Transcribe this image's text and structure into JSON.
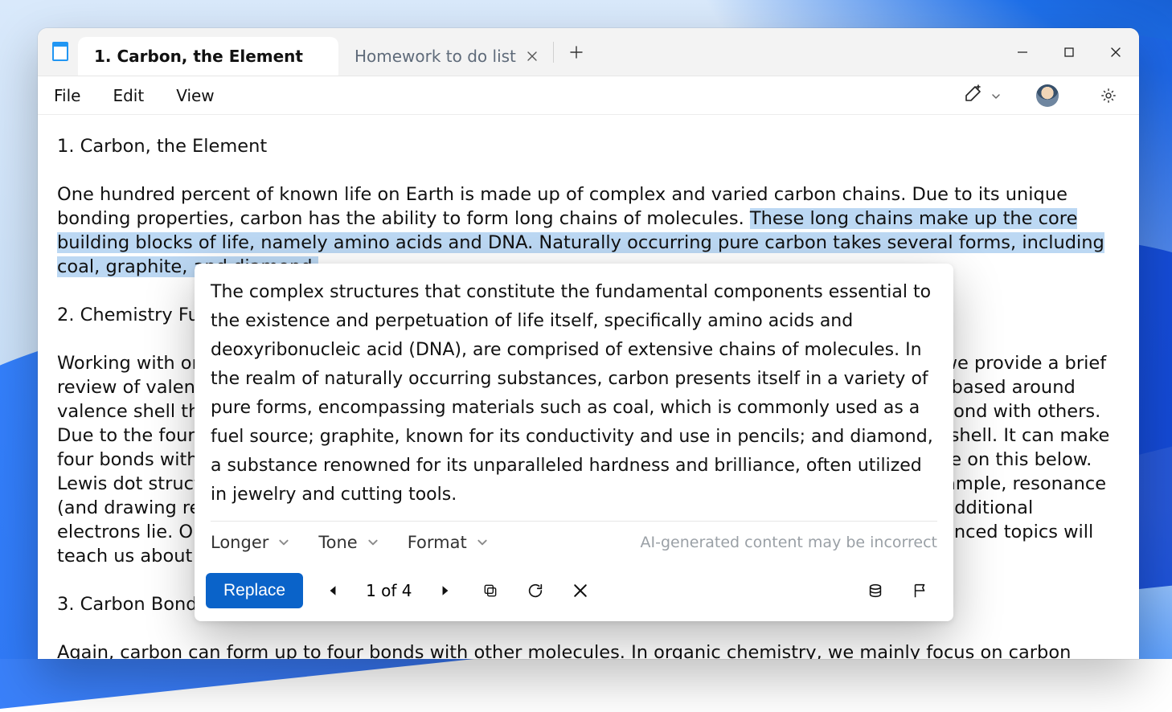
{
  "tabs": {
    "active_title": "1. Carbon, the Element",
    "inactive_title": "Homework to do list"
  },
  "menu": {
    "file": "File",
    "edit": "Edit",
    "view": "View"
  },
  "document": {
    "h1": "1. Carbon, the Element",
    "p1_a": "One hundred percent of known life on Earth is made up of complex and varied carbon chains. Due to its unique bonding properties, carbon has the ability to form long chains of molecules. ",
    "p1_sel": "These long chains make up the core building blocks of life, namely amino acids and DNA. Naturally occurring pure carbon takes several forms, including coal, graphite, and diamond.",
    "h2": "2. Chemistry Fundam",
    "p2": "Working with organic chemistry will require a strong basis in basic chemistry fundamentals. Here we provide a brief review of valence shell theory, Lewis dot structures, and orbital shells. Our study of carbon will be based around valence shell theory—the idea that atoms seek to fill their outer ring of orbiting electrons, and to bond with others. Due to the four electrons in its outer valence shell, carbon must form four bonds to complete that shell. It can make four bonds with other atoms or molecules. Carbon can also form double or even triple bonds—more on this below. Lewis dot structures play a pivotal role in determining the bond that a carbon atom makes. For example, resonance (and drawing resonant structures) can help determine where the additional bonds are and where additional electrons lie. Orbital shells can help illuminate the eventual shape of the molecule—the more advanced topics will teach us about how precise a molecule can tell us its basic shape",
    "h3": "3. Carbon Bonds in C",
    "p3": "Again, carbon can form up to four bonds with other molecules. In organic chemistry, we mainly focus on carbon chains with hydrogen and oxygen, but there are infinite possible compounds. In the simplest form, carbon bonds with four hydrogen in single bonds. In other instances,"
  },
  "popup": {
    "body": "The complex structures that constitute the fundamental components essential to the existence and perpetuation of life itself, specifically amino acids and deoxyribonucleic acid (DNA), are comprised of extensive chains of molecules. In the realm of naturally occurring substances, carbon presents itself in a variety of pure forms, encompassing materials such as coal, which is commonly used as a fuel source; graphite, known for its conductivity and use in pencils; and diamond, a substance renowned for its unparalleled hardness and brilliance, often utilized in jewelry and cutting tools.",
    "longer": "Longer",
    "tone": "Tone",
    "format": "Format",
    "disclaimer": "AI-generated content may be incorrect",
    "replace": "Replace",
    "counter": "1 of 4"
  }
}
